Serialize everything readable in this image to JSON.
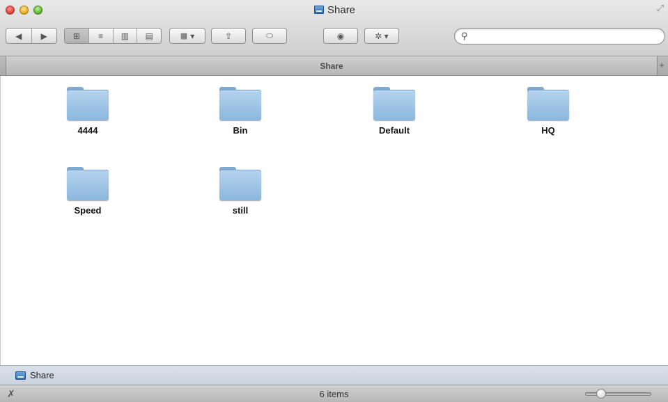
{
  "window": {
    "title": "Share"
  },
  "toolbar": {
    "back_label": "◀",
    "forward_label": "▶",
    "view_icon_label": "⊞",
    "view_list_label": "≡",
    "view_column_label": "▥",
    "view_coverflow_label": "▤",
    "arrange_label": "▾",
    "share_label": "⇪",
    "tag_label": "⬭",
    "quicklook_label": "◉",
    "action_label": "✲ ▾"
  },
  "search": {
    "placeholder": "",
    "value": ""
  },
  "tabbar": {
    "tab_label": "Share",
    "add_label": "+"
  },
  "items": [
    {
      "name": "4444"
    },
    {
      "name": "Bin"
    },
    {
      "name": "Default"
    },
    {
      "name": "HQ"
    },
    {
      "name": "Speed"
    },
    {
      "name": "still"
    }
  ],
  "pathbar": {
    "path_label": "Share"
  },
  "statusbar": {
    "status_text": "6 items",
    "icon_size_fraction": 0.2
  },
  "colors": {
    "folder": "#9fc4e6",
    "pathbar": "#d0d8e2",
    "toolbar": "#dcdcdc"
  }
}
